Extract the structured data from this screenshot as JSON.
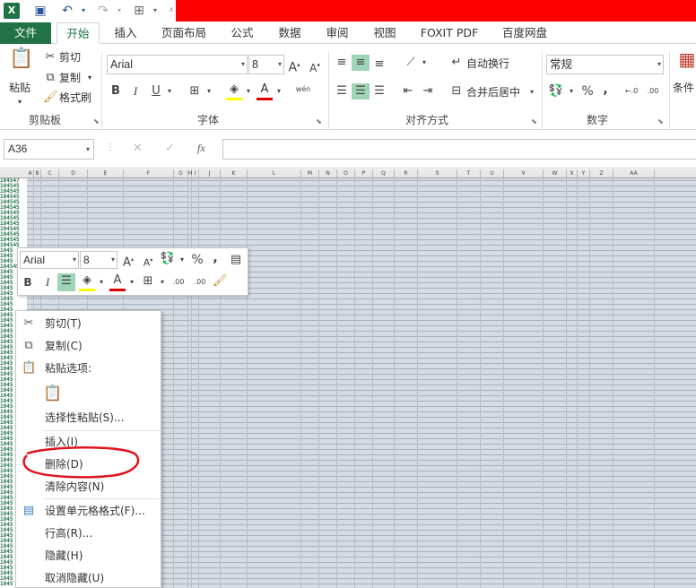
{
  "qat": {
    "undo_icon": "undo-icon",
    "redo_icon": "redo-icon",
    "save_icon": "save-icon"
  },
  "tabs": [
    "文件",
    "开始",
    "插入",
    "页面布局",
    "公式",
    "数据",
    "审阅",
    "视图",
    "FOXIT PDF",
    "百度网盘"
  ],
  "ribbon": {
    "clipboard": {
      "paste": "粘贴",
      "cut": "剪切",
      "copy": "复制",
      "format_painter": "格式刷",
      "label": "剪贴板"
    },
    "font": {
      "name": "Arial",
      "size": "8",
      "label": "字体",
      "bold": "B",
      "italic": "I",
      "underline": "U",
      "phonetic": "wén"
    },
    "alignment": {
      "wrap": "自动换行",
      "merge": "合并后居中",
      "label": "对齐方式"
    },
    "number": {
      "format": "常规",
      "percent": "%",
      "comma": ",",
      "label": "数字"
    },
    "styles": {
      "conditional": "条件"
    }
  },
  "formula_bar": {
    "name_box": "A36",
    "cancel": "✕",
    "enter": "✓",
    "fx": "fx",
    "value": ""
  },
  "columns": [
    "A",
    "B",
    "C",
    "D",
    "E",
    "F",
    "G",
    "H",
    "I",
    "J",
    "K",
    "L",
    "M",
    "N",
    "O",
    "P",
    "Q",
    "R",
    "S",
    "T",
    "U",
    "V",
    "W",
    "X",
    "Y",
    "Z",
    "AA"
  ],
  "row_labels": [
    "104547",
    "104545",
    "104545",
    "104545",
    "104545",
    "104545",
    "104545",
    "104545",
    "104545",
    "104545",
    "104545",
    "104545",
    "104545",
    "1045",
    "1045",
    "1045",
    "104549",
    "1045",
    "1045",
    "1045",
    "1045",
    "1045",
    "1045",
    "1045",
    "1045",
    "1045",
    "1045",
    "1045",
    "1045",
    "1045",
    "1045",
    "1045",
    "1045",
    "1045",
    "1045",
    "1045",
    "1045",
    "1045",
    "1045",
    "1045",
    "1045",
    "1045",
    "1045",
    "1045",
    "1045",
    "1045",
    "1045",
    "1045",
    "1045",
    "1045",
    "1045",
    "1045",
    "1045",
    "1045",
    "1045",
    "1045",
    "1045",
    "1045",
    "1045",
    "1045",
    "1045",
    "1045",
    "1045",
    "1045",
    "1045",
    "1045",
    "1045",
    "1045",
    "1045",
    "1045",
    "1045",
    "1045",
    "1045",
    "1045",
    "1045",
    "1045"
  ],
  "mini_toolbar": {
    "font": "Arial",
    "size": "8",
    "percent": "%",
    "comma": ",",
    "bold": "B",
    "italic": "I",
    "increase_decimal": ".00",
    "decrease_decimal": ".00"
  },
  "context_menu": {
    "cut": "剪切(T)",
    "copy": "复制(C)",
    "paste_options": "粘贴选项:",
    "paste_special": "选择性粘贴(S)...",
    "insert": "插入(I)",
    "delete": "删除(D)",
    "clear": "清除内容(N)",
    "format_cells": "设置单元格格式(F)...",
    "row_height": "行高(R)...",
    "hide": "隐藏(H)",
    "unhide": "取消隐藏(U)"
  },
  "colors": {
    "excel_green": "#217346",
    "highlight": "#9fd5b7",
    "annotation_red": "#e0141e",
    "banner_red": "#ff0000"
  }
}
